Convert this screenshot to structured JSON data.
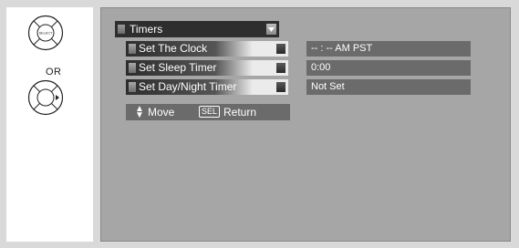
{
  "remote": {
    "select_label": "SELECT",
    "or_label": "OR"
  },
  "menu": {
    "title": "Timers",
    "items": [
      {
        "label": "Set The Clock",
        "value": "-- : -- AM PST"
      },
      {
        "label": "Set Sleep Timer",
        "value": "0:00"
      },
      {
        "label": "Set Day/Night Timer",
        "value": "Not Set"
      }
    ]
  },
  "help": {
    "move_label": "Move",
    "sel_label": "SEL",
    "return_label": "Return"
  },
  "colors": {
    "page_bg": "#d9d9d9",
    "screen_bg": "#a6a6a6",
    "menu_dark": "#2e2e2e",
    "value_bg": "#6b6b6b"
  }
}
